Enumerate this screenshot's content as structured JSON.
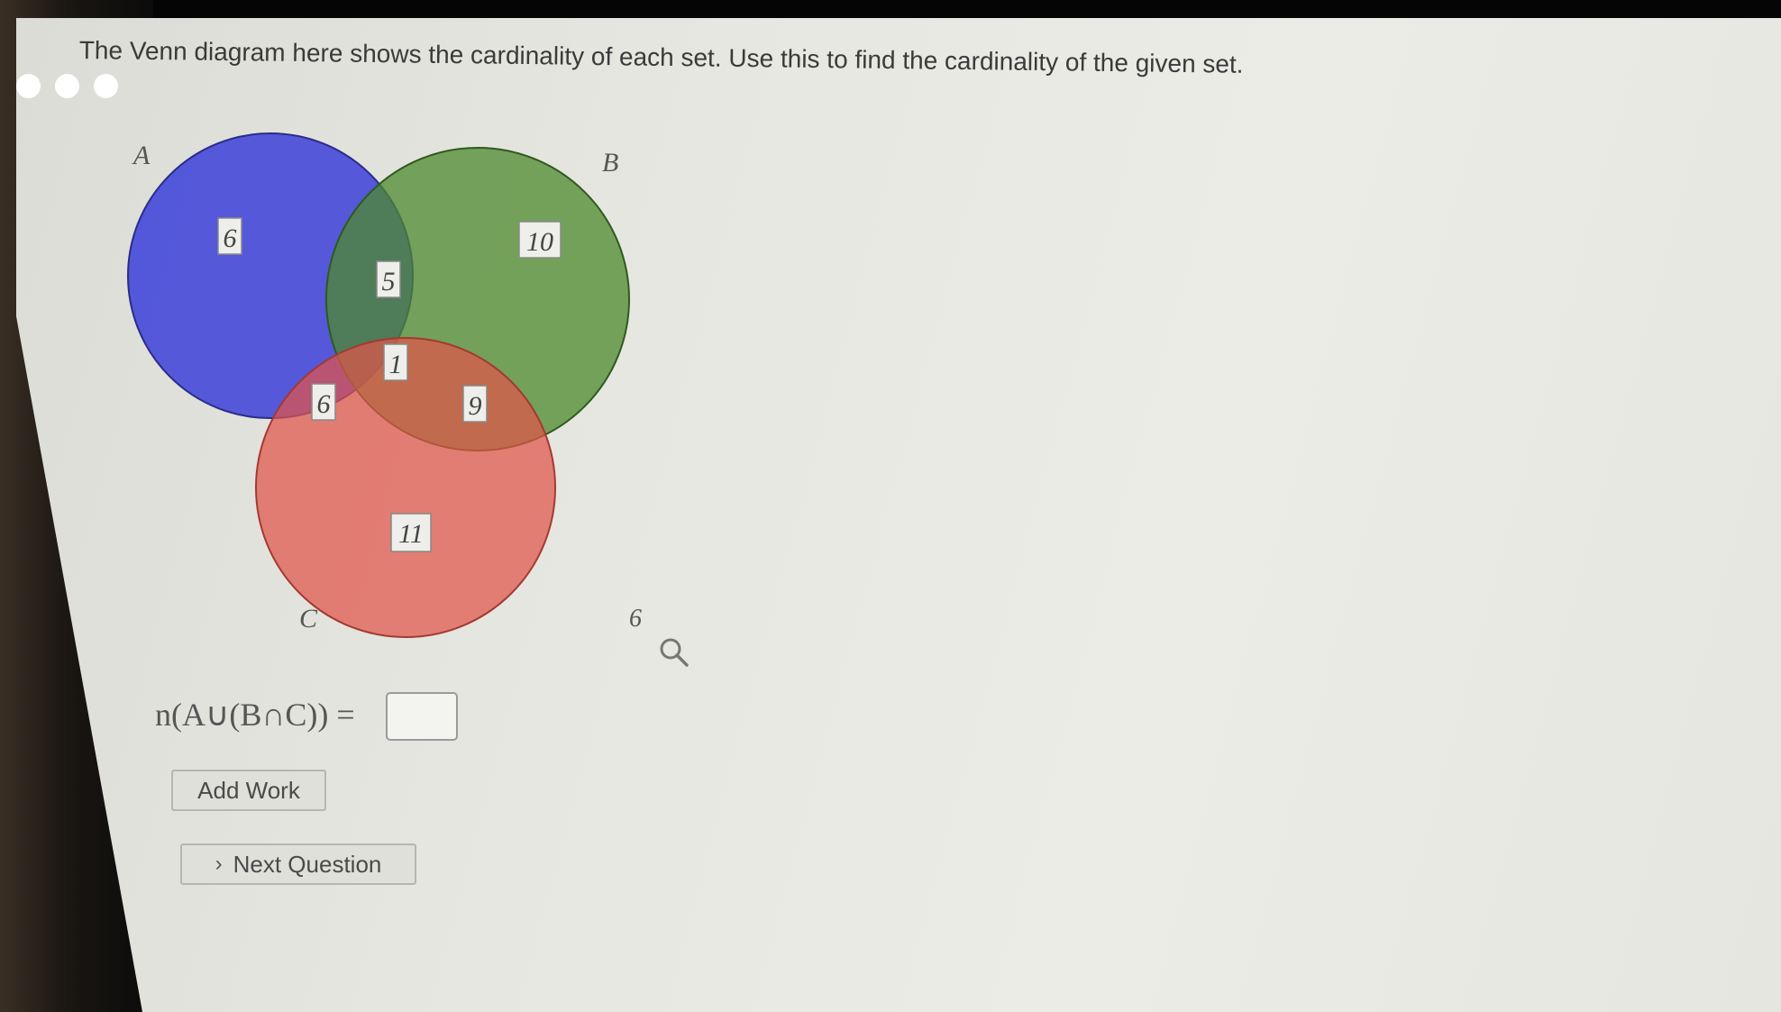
{
  "prompt": "The Venn diagram here shows the cardinality of each set. Use this to find the cardinality of the given set.",
  "venn": {
    "sets": [
      {
        "name": "A",
        "color": "#3b3fd8"
      },
      {
        "name": "B",
        "color": "#4e8a2e"
      },
      {
        "name": "C",
        "color": "#e0544a"
      }
    ],
    "regions": {
      "a_only": "6",
      "b_only": "10",
      "a_and_b_only": "5",
      "a_and_b_and_c": "1",
      "a_and_c_only": "6",
      "b_and_c_only": "9",
      "c_only": "11"
    },
    "outside": "6"
  },
  "expression": "n(A∪(B∩C)) =",
  "answer": {
    "value": ""
  },
  "buttons": {
    "add_work": "Add Work",
    "next_question": "Next Question"
  }
}
